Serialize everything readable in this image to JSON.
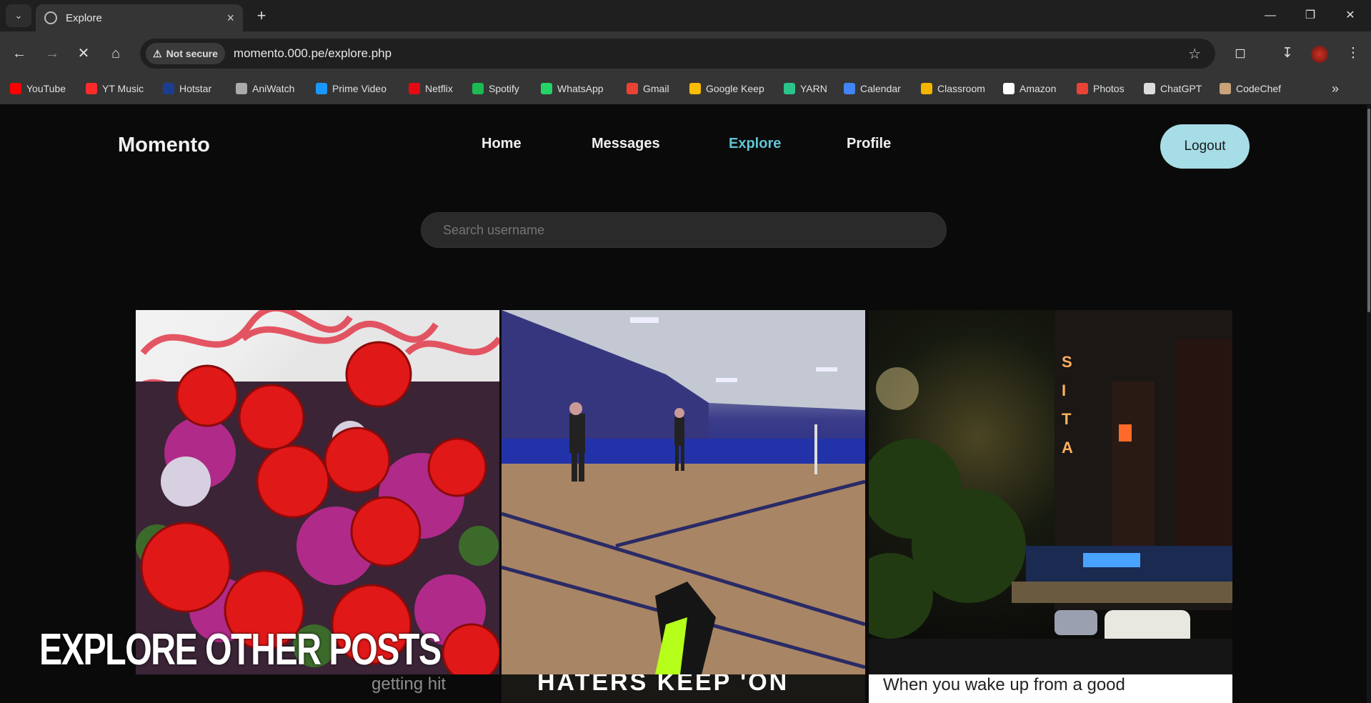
{
  "browser": {
    "tab_title": "Explore",
    "not_secure_label": "Not secure",
    "url": "momento.000.pe/explore.php",
    "bookmarks": [
      {
        "label": "YouTube",
        "icon": "youtube-icon",
        "color": "#ff0000"
      },
      {
        "label": "YT Music",
        "icon": "yt-music-icon",
        "color": "#ff2a2a"
      },
      {
        "label": "Hotstar",
        "icon": "hotstar-icon",
        "color": "#1c3d8f"
      },
      {
        "label": "AniWatch",
        "icon": "aniwatch-icon",
        "color": "#aaaaaa"
      },
      {
        "label": "Prime Video",
        "icon": "prime-video-icon",
        "color": "#1a98ff"
      },
      {
        "label": "Netflix",
        "icon": "netflix-icon",
        "color": "#e50914"
      },
      {
        "label": "Spotify",
        "icon": "spotify-icon",
        "color": "#1db954"
      },
      {
        "label": "WhatsApp",
        "icon": "whatsapp-icon",
        "color": "#25d366"
      },
      {
        "label": "Gmail",
        "icon": "gmail-icon",
        "color": "#ea4335"
      },
      {
        "label": "Google Keep",
        "icon": "google-keep-icon",
        "color": "#fbbc04"
      },
      {
        "label": "YARN",
        "icon": "yarn-icon",
        "color": "#2bc48a"
      },
      {
        "label": "Calendar",
        "icon": "calendar-icon",
        "color": "#4285f4"
      },
      {
        "label": "Classroom",
        "icon": "classroom-icon",
        "color": "#f4b400"
      },
      {
        "label": "Amazon",
        "icon": "amazon-icon",
        "color": "#ffffff"
      },
      {
        "label": "Photos",
        "icon": "photos-icon",
        "color": "#ea4335"
      },
      {
        "label": "ChatGPT",
        "icon": "chatgpt-icon",
        "color": "#dddddd"
      },
      {
        "label": "CodeChef",
        "icon": "codechef-icon",
        "color": "#c9a27a"
      }
    ]
  },
  "site": {
    "logo": "Momento",
    "nav": [
      {
        "label": "Home",
        "active": false
      },
      {
        "label": "Messages",
        "active": false
      },
      {
        "label": "Explore",
        "active": true
      },
      {
        "label": "Profile",
        "active": false
      }
    ],
    "logout_label": "Logout",
    "search_placeholder": "Search username",
    "accent": "#5fc4d6",
    "posts": [
      {
        "caption": "getting hit"
      },
      {
        "caption": "HATERS KEEP 'ON"
      },
      {
        "caption": "When you wake up from a good"
      }
    ],
    "overlay_text": "EXPLORE OTHER POSTS"
  }
}
